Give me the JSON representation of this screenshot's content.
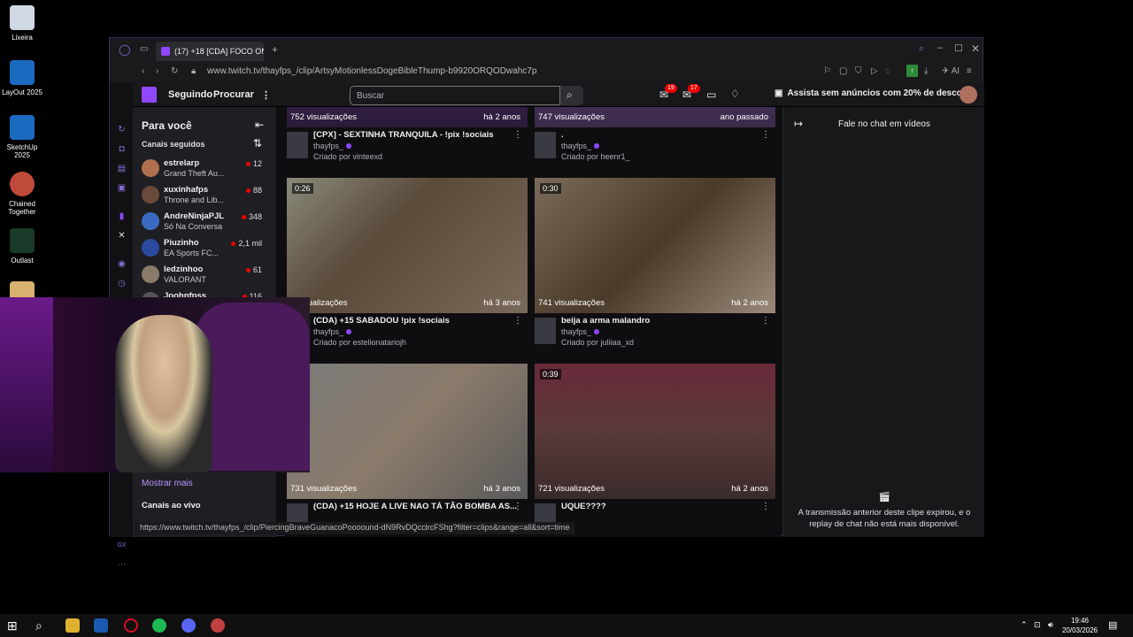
{
  "desktop": {
    "icons": [
      {
        "label": "Lixeira"
      },
      {
        "label": "LayOut 2025"
      },
      {
        "label": "SketchUp 2025"
      },
      {
        "label": "Chained Together"
      },
      {
        "label": "Outlast"
      }
    ]
  },
  "browser": {
    "tab_title": "(17) +18 [CDA] FOCO ON",
    "url": "www.twitch.tv/thayfps_/clip/ArtsyMotionlessDogeBibleThump-b9920ORQODwahc7p",
    "status_url": "https://www.twitch.tv/thayfps_/clip/PiercingBraveGuanacoPoooound-dN9RvDQcclrcFShg?filter=clips&range=all&sort=time",
    "ai_label": "AI"
  },
  "twitch": {
    "nav": {
      "following": "Seguindo",
      "browse": "Procurar",
      "search_placeholder": "Buscar",
      "promo": "Assista sem anúncios com 20% de desconto",
      "inbox_badge": "19",
      "notif_badge": "17"
    },
    "sidebar": {
      "title": "Para você",
      "followed_label": "Canais seguidos",
      "channels": [
        {
          "name": "estrelarp",
          "game": "Grand Theft Au...",
          "viewers": "12",
          "color": "#b07050"
        },
        {
          "name": "xuxinhafps",
          "game": "Throne and Lib...",
          "viewers": "88",
          "color": "#6a4a3a"
        },
        {
          "name": "AndreNinjaPJL",
          "game": "Só Na Conversa",
          "viewers": "348",
          "color": "#3a6ac0"
        },
        {
          "name": "Piuzinho",
          "game": "EA Sports FC...",
          "viewers": "2,1 mil",
          "color": "#2a4aa0"
        },
        {
          "name": "ledzinhoo",
          "game": "VALORANT",
          "viewers": "61",
          "color": "#8a7a6a"
        },
        {
          "name": "Joohnfpss",
          "game": "",
          "viewers": "116",
          "color": "#555"
        }
      ],
      "show_more": "Mostrar mais",
      "live_channels": "Canais ao vivo"
    },
    "clips": [
      {
        "duration": "",
        "views": "752 visualizações",
        "age": "há 2 anos",
        "title": "[CPX] - SEXTINHA TRANQUILA - !pix !sociais",
        "channel": "thayfps_",
        "creator": "Criado por vinteexd"
      },
      {
        "duration": "",
        "views": "747 visualizações",
        "age": "ano passado",
        "title": ".",
        "channel": "thayfps_",
        "creator": "Criado por heenr1_"
      },
      {
        "duration": "0:26",
        "views": "2 visualizações",
        "age": "há 3 anos",
        "title": "(CDA) +15 SABADOU !pix !sociais",
        "channel": "thayfps_",
        "creator": "Criado por estelionatariojh"
      },
      {
        "duration": "0:30",
        "views": "741 visualizações",
        "age": "há 2 anos",
        "title": "beija a arma malandro",
        "channel": "thayfps_",
        "creator": "Criado por juliiaa_xd"
      },
      {
        "duration": "",
        "views": "731 visualizações",
        "age": "há 3 anos",
        "title": "(CDA) +15 HOJE A LIVE NAO TÁ TÃO BOMBA AS...",
        "channel": "",
        "creator": ""
      },
      {
        "duration": "0:39",
        "views": "721 visualizações",
        "age": "há 2 anos",
        "title": "UQUE????",
        "channel": "",
        "creator": ""
      }
    ],
    "chat": {
      "title": "Fale no chat em vídeos",
      "message": "A transmissão anterior deste clipe expirou, e o replay de chat não está mais disponível."
    }
  },
  "taskbar": {
    "time": "19:46",
    "date": "20/03/2026"
  },
  "colors": {
    "twitch_purple": "#9146ff",
    "live_red": "#eb0400",
    "background": "#0e0e10"
  }
}
